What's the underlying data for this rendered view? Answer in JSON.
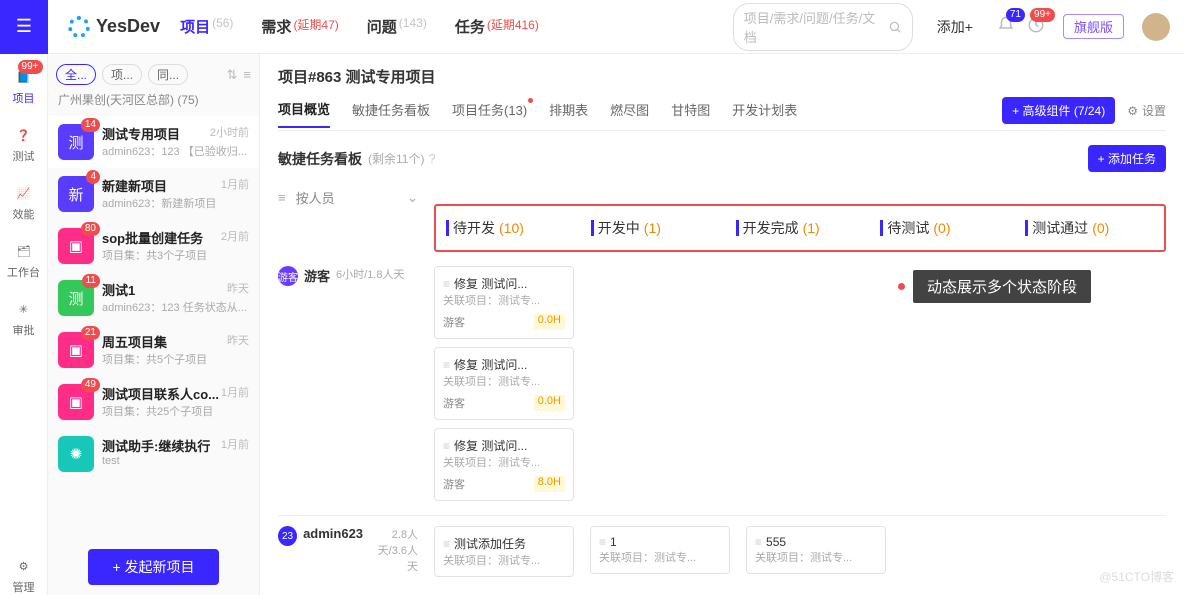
{
  "header": {
    "brand": "YesDev",
    "nav": [
      {
        "label": "项目",
        "sup": "(56)",
        "active": true,
        "red": false
      },
      {
        "label": "需求",
        "sup": "(延期47)",
        "red": true
      },
      {
        "label": "问题",
        "sup": "(143)",
        "red": false
      },
      {
        "label": "任务",
        "sup": "(延期416)",
        "red": true
      }
    ],
    "search_ph": "项目/需求/问题/任务/文档",
    "add": "添加+",
    "bell_count": "71",
    "clock_count": "99+",
    "flag": "旗舰版"
  },
  "rail": [
    {
      "label": "项目",
      "icon": "📘",
      "badge": "99+",
      "active": true
    },
    {
      "label": "测试",
      "icon": "❓"
    },
    {
      "label": "效能",
      "icon": "📈"
    },
    {
      "label": "工作台",
      "icon": "🗂"
    },
    {
      "label": "审批",
      "icon": "✳"
    }
  ],
  "rail_bottom": {
    "label": "管理",
    "icon": "⚙"
  },
  "list": {
    "filters": [
      "全...",
      "项...",
      "同..."
    ],
    "crumb": "广州果创(天河区总部)  (75)",
    "items": [
      {
        "ava": "测",
        "color": "#5a3cff",
        "badge": "14",
        "name": "测试专用项目",
        "sub": "admin623：123 【已验收归...",
        "time": "2小时前",
        "sel": true
      },
      {
        "ava": "新",
        "color": "#5a3cff",
        "badge": "4",
        "name": "新建新项目",
        "sub": "admin623：新建新项目 <br...",
        "time": "1月前"
      },
      {
        "ava": "▣",
        "color": "#ff2d88",
        "badge": "80",
        "name": "sop批量创建任务",
        "sub": "项目集：共3个子项目",
        "time": "2月前"
      },
      {
        "ava": "测",
        "color": "#34c759",
        "badge": "11",
        "name": "测试1",
        "sub": "admin623：123 任务状态从...",
        "time": "昨天"
      },
      {
        "ava": "▣",
        "color": "#ff2d88",
        "badge": "21",
        "name": "周五项目集",
        "sub": "项目集：共5个子项目",
        "time": "昨天"
      },
      {
        "ava": "▣",
        "color": "#ff2d88",
        "badge": "49",
        "name": "测试项目联系人co...",
        "sub": "项目集：共25个子项目",
        "time": "1月前"
      },
      {
        "ava": "✺",
        "color": "#17c7b7",
        "name": "测试助手:继续执行",
        "sub": "test",
        "time": "1月前"
      }
    ],
    "new_btn": "+ 发起新项目"
  },
  "main": {
    "title": "项目#863 测试专用项目",
    "tabs": [
      "项目概览",
      "敏捷任务看板",
      "项目任务(13)",
      "排期表",
      "燃尽图",
      "甘特图",
      "开发计划表"
    ],
    "adv": "+ 高级组件 (7/24)",
    "settings": "设置",
    "board_title": "敏捷任务看板",
    "board_rest": "(剩余11个)",
    "add_task": "+ 添加任务",
    "group_label": "按人员",
    "cols": [
      {
        "name": "待开发",
        "cnt": "(10)"
      },
      {
        "name": "开发中",
        "cnt": "(1)"
      },
      {
        "name": "开发完成",
        "cnt": "(1)"
      },
      {
        "name": "待测试",
        "cnt": "(0)"
      },
      {
        "name": "测试通过",
        "cnt": "(0)"
      }
    ],
    "annot": "动态展示多个状态阶段",
    "lane1": {
      "ava": "游客",
      "name": "游客",
      "time": "6小时/1.8人天",
      "cards": [
        {
          "t": "修复 测试问...",
          "s": "关联项目：测试专...",
          "u": "游客",
          "h": "0.0H"
        },
        {
          "t": "修复 测试问...",
          "s": "关联项目：测试专...",
          "u": "游客",
          "h": "0.0H"
        },
        {
          "t": "修复 测试问...",
          "s": "关联项目：测试专...",
          "u": "游客",
          "h": "8.0H"
        }
      ]
    },
    "lane2": {
      "ava": "23",
      "name": "admin623",
      "time": "天/3.6人天",
      "pre": "2.8人",
      "c1": {
        "t": "测试添加任务",
        "s": "关联项目：测试专..."
      },
      "c2": {
        "t": "1",
        "s": "关联项目：测试专..."
      },
      "c3": {
        "t": "555",
        "s": "关联项目：测试专..."
      }
    }
  },
  "watermark": "@51CTO博客"
}
